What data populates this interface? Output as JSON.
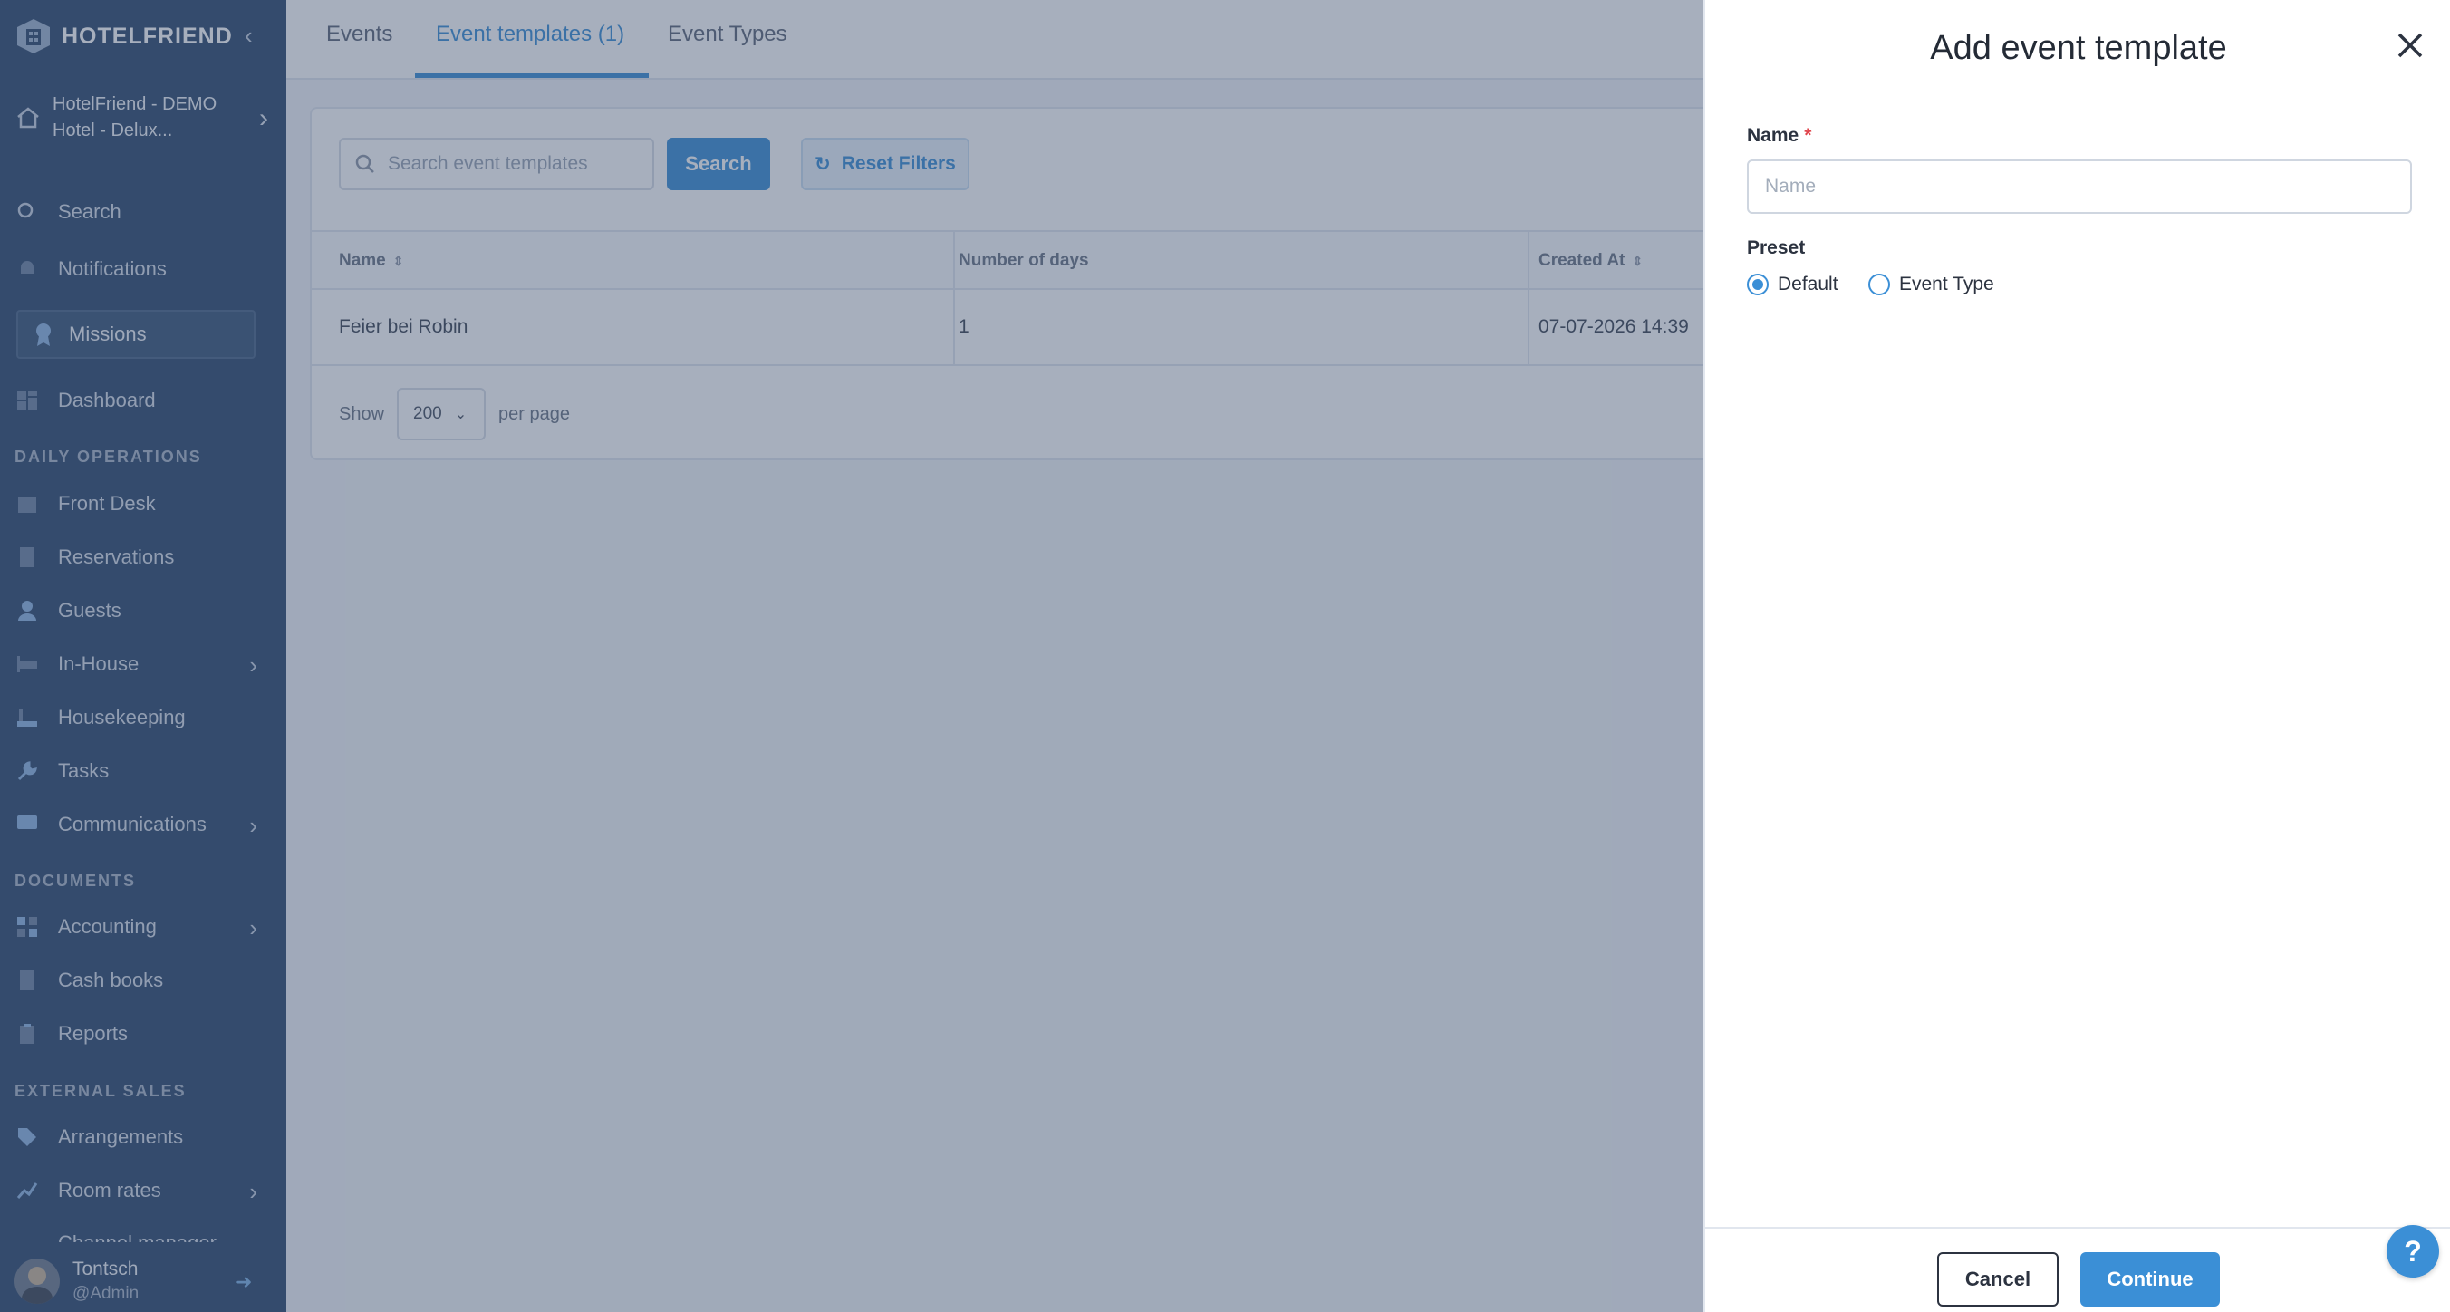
{
  "sidebar": {
    "brand": "HOTELFRIEND",
    "hotel_name": "HotelFriend - DEMO Hotel - Delux...",
    "items": {
      "search": "Search",
      "notifications": "Notifications",
      "missions": "Missions",
      "dashboard": "Dashboard",
      "front_desk": "Front Desk",
      "reservations": "Reservations",
      "guests": "Guests",
      "in_house": "In-House",
      "housekeeping": "Housekeeping",
      "tasks": "Tasks",
      "communications": "Communications",
      "accounting": "Accounting",
      "cash_books": "Cash books",
      "reports": "Reports",
      "arrangements": "Arrangements",
      "room_rates": "Room rates",
      "channel_manager": "Channel manager"
    },
    "sections": {
      "daily_operations": "DAILY OPERATIONS",
      "documents": "DOCUMENTS",
      "external_sales": "EXTERNAL SALES"
    },
    "user": {
      "name": "Tontsch",
      "role": "@Admin"
    }
  },
  "tabs": {
    "events": "Events",
    "event_templates": "Event templates (1)",
    "event_types": "Event Types"
  },
  "filters": {
    "search_placeholder": "Search event templates",
    "search_button": "Search",
    "reset_button": "Reset Filters"
  },
  "table": {
    "headers": {
      "name": "Name",
      "days": "Number of days",
      "created": "Created At"
    },
    "rows": [
      {
        "name": "Feier bei Robin",
        "days": "1",
        "created": "07-07-2026 14:39"
      }
    ]
  },
  "pager": {
    "show": "Show",
    "value": "200",
    "per_page": "per page"
  },
  "drawer": {
    "title": "Add event template",
    "name_label": "Name",
    "name_required": "*",
    "name_placeholder": "Name",
    "name_value": "",
    "preset_label": "Preset",
    "preset_options": {
      "default": "Default",
      "event_type": "Event Type"
    },
    "preset_selected": "Default",
    "cancel": "Cancel",
    "continue": "Continue"
  },
  "help": "?",
  "colors": {
    "accent": "#3b8fd6",
    "sidebar": "#2f4a6e",
    "required": "#e0454c"
  }
}
